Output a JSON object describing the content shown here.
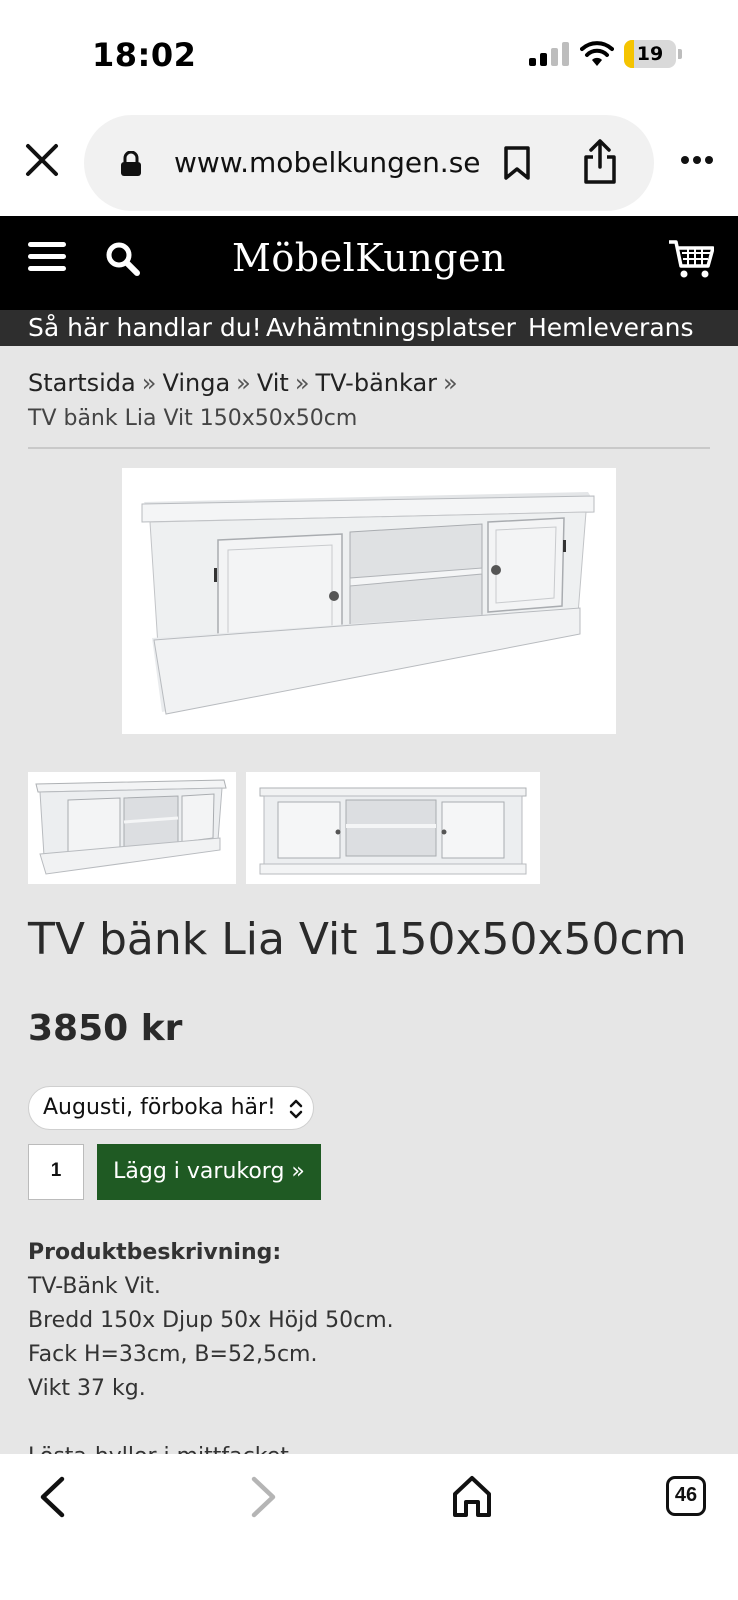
{
  "status_bar": {
    "time": "18:02",
    "battery": "19",
    "battery_level": 0.19
  },
  "browser": {
    "url": "www.mobelkungen.se",
    "tabs_count": "46"
  },
  "site": {
    "logo": "MöbelKungen",
    "nav": [
      "Så här handlar du!",
      "Avhämtningsplatser",
      "Hemleverans"
    ]
  },
  "breadcrumb": {
    "items": [
      "Startsida",
      "Vinga",
      "Vit",
      "TV-bänkar"
    ],
    "separator": "»",
    "current": "TV bänk Lia Vit 150x50x50cm"
  },
  "product": {
    "title": "TV bänk Lia Vit 150x50x50cm",
    "price": "3850 kr",
    "delivery_option": "Augusti, förboka här!",
    "quantity": "1",
    "add_to_cart_label": "Lägg i varukorg »",
    "description_heading": "Produktbeskrivning:",
    "description_lines": [
      "TV-Bänk Vit.",
      "Bredd 150x Djup 50x Höjd 50cm.",
      "Fack H=33cm, B=52,5cm.",
      "Vikt 37 kg."
    ],
    "description_cut": "Lösta-hyllor i mittfacket"
  },
  "colors": {
    "header_bg": "#000000",
    "subnav_bg": "#2e2e2e",
    "page_bg": "#e6e6e6",
    "button_green": "#1f5a23"
  }
}
